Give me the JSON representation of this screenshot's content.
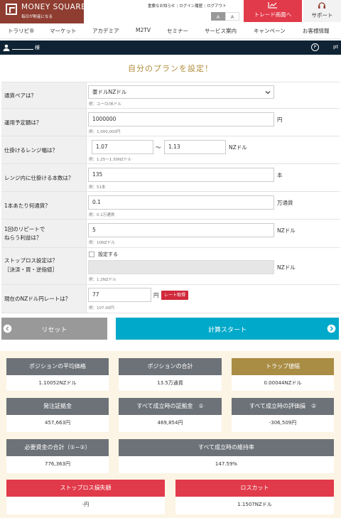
{
  "header": {
    "logo_name": "MONEY SQUARE",
    "logo_tagline": "毎日が財産になる",
    "top_links": [
      "重要なお知らせ",
      "ログイン履歴",
      "ログアウト"
    ],
    "font_size_small": "A",
    "font_size_large": "A",
    "trade_button": "トレード画面へ",
    "support_button": "サポート"
  },
  "nav": {
    "items": [
      "トラリピ®",
      "マーケット",
      "アカデミア",
      "M2TV",
      "セミナー",
      "サービス案内",
      "キャンペーン",
      "お客様情報"
    ]
  },
  "user_bar": {
    "honorific": "様",
    "points_icon": "P",
    "points_label": "pt"
  },
  "page_title": "自分のプランを設定！",
  "form": {
    "currency_pair": {
      "label": "通貨ペアは？",
      "value": "豪ドルNZドル",
      "example": "例：ユーロ/米ドル"
    },
    "funds": {
      "label": "運用予定額は？",
      "value": "1000000",
      "unit": "円",
      "example": "例：1,000,000円"
    },
    "range": {
      "label": "仕掛けるレンジ幅は？",
      "from": "1.07",
      "tilde": "〜",
      "to": "1.13",
      "unit": "NZドル",
      "example": "例：1.25〜1.30NZドル"
    },
    "count": {
      "label": "レンジ内に仕掛ける本数は？",
      "value": "135",
      "unit": "本",
      "example": "例：51本"
    },
    "size": {
      "label": "1本あたり何通貨？",
      "value": "0.1",
      "unit": "万通貨",
      "example": "例：0.1万通貨"
    },
    "profit": {
      "label_line1": "1回のリピートで",
      "label_line2": "ねらう利益は？",
      "value": "5",
      "unit": "NZドル",
      "example": "例：10NZドル"
    },
    "stoploss": {
      "label_line1": "ストップロス設定は？",
      "label_line2": "［決済・買・逆指値］",
      "checkbox_label": "設定する",
      "value": "",
      "unit": "NZドル",
      "example": "例：1.2NZドル"
    },
    "rate": {
      "label": "現在のNZドル円レートは？",
      "value": "77",
      "unit": "円",
      "button": "レート取得",
      "example": "例：107.00円"
    }
  },
  "buttons": {
    "reset": "リセット",
    "calculate": "計算スタート"
  },
  "results": {
    "avg_price": {
      "title": "ポジションの平均価格",
      "value": "1.10052NZドル"
    },
    "position_total": {
      "title": "ポジションの合計",
      "value": "13.5万通貨"
    },
    "trap_width": {
      "title": "トラップ値幅",
      "value": "0.00044NZドル"
    },
    "order_margin": {
      "title": "発注証拠金",
      "value": "457,663円"
    },
    "all_filled_margin": {
      "title": "すべて成立時の証拠金　①",
      "value": "469,854円"
    },
    "all_filled_loss": {
      "title": "すべて成立時の評価損　②",
      "value": "-306,509円"
    },
    "required_funds": {
      "title": "必要資金の合計（①−②）",
      "value": "776,363円"
    },
    "maintenance_rate": {
      "title": "すべて成立時の維持率",
      "value": "147.59%"
    },
    "stoploss_amount": {
      "title": "ストップロス損失額",
      "value": "-円"
    },
    "losscut": {
      "title": "ロスカット",
      "value": "1.1507NZドル"
    }
  },
  "colors": {
    "brand": "#8e3d30",
    "trade_red": "#e13a4a",
    "title_gold": "#b08d3a",
    "calc_cyan": "#00a9c9",
    "result_gray": "#6d7278",
    "result_gold": "#a98d44",
    "user_bar": "#0f2334"
  }
}
